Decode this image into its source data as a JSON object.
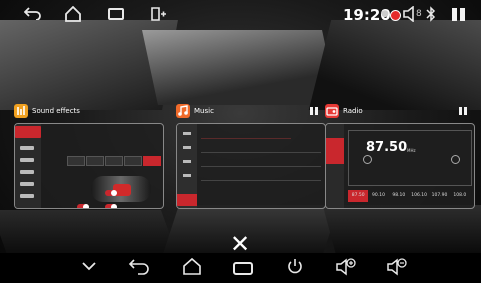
{
  "status_bar": {
    "time": "19:20",
    "icons": [
      "back-arrow-icon",
      "home-icon",
      "recent-apps-icon",
      "split-screen-icon",
      "signal-icon",
      "recording-dot-icon",
      "volume-icon",
      "bluetooth-icon",
      "panel-icon"
    ],
    "recording_color": "#e52b2b",
    "volume_level": "8"
  },
  "widgets": {
    "sound_effects": {
      "title": "Sound effects",
      "icon": "equalizer-icon",
      "icon_color": "#f0a020"
    },
    "music": {
      "title": "Music",
      "icon": "music-note-icon",
      "icon_color": "#f06a2a"
    },
    "radio": {
      "title": "Radio",
      "icon": "radio-icon",
      "icon_color": "#e53935",
      "frequency": "87.50",
      "unit": "MHz",
      "presets": [
        "87.50",
        "90.10",
        "98.10",
        "106.10",
        "107.90",
        "108.0"
      ],
      "active_preset_index": 0
    }
  },
  "close_icon": "close-icon",
  "nav_bar": {
    "icons": [
      "chevron-down-icon",
      "back-arrow-icon",
      "home-icon",
      "recent-apps-icon",
      "power-icon",
      "volume-up-icon",
      "volume-down-icon"
    ]
  },
  "accent_color": "#c9272d"
}
